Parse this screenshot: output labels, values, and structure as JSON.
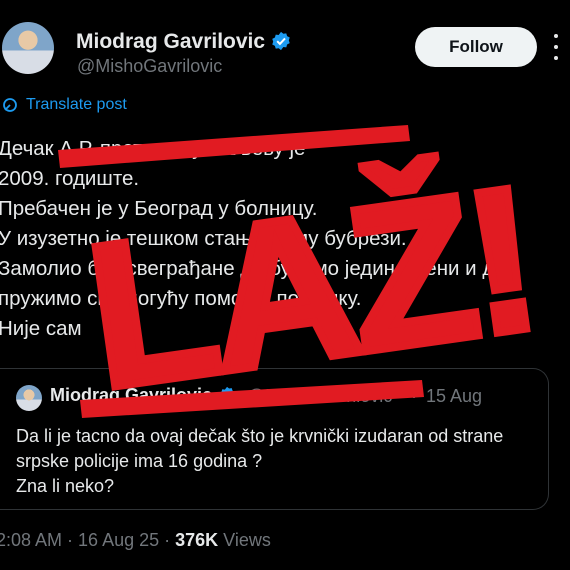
{
  "author": {
    "name": "Miodrag Gavrilovic",
    "handle": "@MishoGavrilovic"
  },
  "follow_label": "Follow",
  "translate_label": "Translate post",
  "post_lines": [
    "Дечак А.Р.   претучен у Ваљеву је",
    "2009. годиште.",
    "Пребачен је у Београд у    болницу.",
    "У изузетно је тешком стању   су му бубрези.",
    "Замолио бих свеграђане да будемо јединствени и да",
    "пружимо сву могућу помоћ и подршку.",
    "Није сам"
  ],
  "quote": {
    "name": "Miodrag Gavrilovic",
    "handle": "@MishoGavrilovic",
    "separator": "·",
    "date": "15 Aug",
    "lines": [
      "Da li je tacno da ovaj dečak što je krvnički izudaran od strane",
      "srpske policije ima 16 godina ?",
      "Zna li neko?"
    ]
  },
  "meta": {
    "time": "2:08 AM · 16 Aug 25 · ",
    "views_count": "376K",
    "views_label": " Views"
  },
  "stamp": {
    "text": "LAŽ!",
    "color": "#e11b22"
  },
  "colors": {
    "accent": "#1d9bf0",
    "stamp": "#e11b22"
  }
}
